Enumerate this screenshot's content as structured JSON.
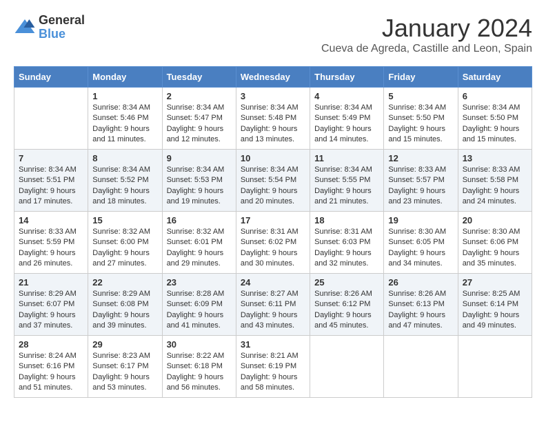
{
  "logo": {
    "general": "General",
    "blue": "Blue"
  },
  "header": {
    "month": "January 2024",
    "location": "Cueva de Agreda, Castille and Leon, Spain"
  },
  "weekdays": [
    "Sunday",
    "Monday",
    "Tuesday",
    "Wednesday",
    "Thursday",
    "Friday",
    "Saturday"
  ],
  "weeks": [
    [
      {
        "day": "",
        "sunrise": "",
        "sunset": "",
        "daylight": ""
      },
      {
        "day": "1",
        "sunrise": "Sunrise: 8:34 AM",
        "sunset": "Sunset: 5:46 PM",
        "daylight": "Daylight: 9 hours and 11 minutes."
      },
      {
        "day": "2",
        "sunrise": "Sunrise: 8:34 AM",
        "sunset": "Sunset: 5:47 PM",
        "daylight": "Daylight: 9 hours and 12 minutes."
      },
      {
        "day": "3",
        "sunrise": "Sunrise: 8:34 AM",
        "sunset": "Sunset: 5:48 PM",
        "daylight": "Daylight: 9 hours and 13 minutes."
      },
      {
        "day": "4",
        "sunrise": "Sunrise: 8:34 AM",
        "sunset": "Sunset: 5:49 PM",
        "daylight": "Daylight: 9 hours and 14 minutes."
      },
      {
        "day": "5",
        "sunrise": "Sunrise: 8:34 AM",
        "sunset": "Sunset: 5:50 PM",
        "daylight": "Daylight: 9 hours and 15 minutes."
      },
      {
        "day": "6",
        "sunrise": "Sunrise: 8:34 AM",
        "sunset": "Sunset: 5:50 PM",
        "daylight": "Daylight: 9 hours and 15 minutes."
      }
    ],
    [
      {
        "day": "7",
        "sunrise": "Sunrise: 8:34 AM",
        "sunset": "Sunset: 5:51 PM",
        "daylight": "Daylight: 9 hours and 17 minutes."
      },
      {
        "day": "8",
        "sunrise": "Sunrise: 8:34 AM",
        "sunset": "Sunset: 5:52 PM",
        "daylight": "Daylight: 9 hours and 18 minutes."
      },
      {
        "day": "9",
        "sunrise": "Sunrise: 8:34 AM",
        "sunset": "Sunset: 5:53 PM",
        "daylight": "Daylight: 9 hours and 19 minutes."
      },
      {
        "day": "10",
        "sunrise": "Sunrise: 8:34 AM",
        "sunset": "Sunset: 5:54 PM",
        "daylight": "Daylight: 9 hours and 20 minutes."
      },
      {
        "day": "11",
        "sunrise": "Sunrise: 8:34 AM",
        "sunset": "Sunset: 5:55 PM",
        "daylight": "Daylight: 9 hours and 21 minutes."
      },
      {
        "day": "12",
        "sunrise": "Sunrise: 8:33 AM",
        "sunset": "Sunset: 5:57 PM",
        "daylight": "Daylight: 9 hours and 23 minutes."
      },
      {
        "day": "13",
        "sunrise": "Sunrise: 8:33 AM",
        "sunset": "Sunset: 5:58 PM",
        "daylight": "Daylight: 9 hours and 24 minutes."
      }
    ],
    [
      {
        "day": "14",
        "sunrise": "Sunrise: 8:33 AM",
        "sunset": "Sunset: 5:59 PM",
        "daylight": "Daylight: 9 hours and 26 minutes."
      },
      {
        "day": "15",
        "sunrise": "Sunrise: 8:32 AM",
        "sunset": "Sunset: 6:00 PM",
        "daylight": "Daylight: 9 hours and 27 minutes."
      },
      {
        "day": "16",
        "sunrise": "Sunrise: 8:32 AM",
        "sunset": "Sunset: 6:01 PM",
        "daylight": "Daylight: 9 hours and 29 minutes."
      },
      {
        "day": "17",
        "sunrise": "Sunrise: 8:31 AM",
        "sunset": "Sunset: 6:02 PM",
        "daylight": "Daylight: 9 hours and 30 minutes."
      },
      {
        "day": "18",
        "sunrise": "Sunrise: 8:31 AM",
        "sunset": "Sunset: 6:03 PM",
        "daylight": "Daylight: 9 hours and 32 minutes."
      },
      {
        "day": "19",
        "sunrise": "Sunrise: 8:30 AM",
        "sunset": "Sunset: 6:05 PM",
        "daylight": "Daylight: 9 hours and 34 minutes."
      },
      {
        "day": "20",
        "sunrise": "Sunrise: 8:30 AM",
        "sunset": "Sunset: 6:06 PM",
        "daylight": "Daylight: 9 hours and 35 minutes."
      }
    ],
    [
      {
        "day": "21",
        "sunrise": "Sunrise: 8:29 AM",
        "sunset": "Sunset: 6:07 PM",
        "daylight": "Daylight: 9 hours and 37 minutes."
      },
      {
        "day": "22",
        "sunrise": "Sunrise: 8:29 AM",
        "sunset": "Sunset: 6:08 PM",
        "daylight": "Daylight: 9 hours and 39 minutes."
      },
      {
        "day": "23",
        "sunrise": "Sunrise: 8:28 AM",
        "sunset": "Sunset: 6:09 PM",
        "daylight": "Daylight: 9 hours and 41 minutes."
      },
      {
        "day": "24",
        "sunrise": "Sunrise: 8:27 AM",
        "sunset": "Sunset: 6:11 PM",
        "daylight": "Daylight: 9 hours and 43 minutes."
      },
      {
        "day": "25",
        "sunrise": "Sunrise: 8:26 AM",
        "sunset": "Sunset: 6:12 PM",
        "daylight": "Daylight: 9 hours and 45 minutes."
      },
      {
        "day": "26",
        "sunrise": "Sunrise: 8:26 AM",
        "sunset": "Sunset: 6:13 PM",
        "daylight": "Daylight: 9 hours and 47 minutes."
      },
      {
        "day": "27",
        "sunrise": "Sunrise: 8:25 AM",
        "sunset": "Sunset: 6:14 PM",
        "daylight": "Daylight: 9 hours and 49 minutes."
      }
    ],
    [
      {
        "day": "28",
        "sunrise": "Sunrise: 8:24 AM",
        "sunset": "Sunset: 6:16 PM",
        "daylight": "Daylight: 9 hours and 51 minutes."
      },
      {
        "day": "29",
        "sunrise": "Sunrise: 8:23 AM",
        "sunset": "Sunset: 6:17 PM",
        "daylight": "Daylight: 9 hours and 53 minutes."
      },
      {
        "day": "30",
        "sunrise": "Sunrise: 8:22 AM",
        "sunset": "Sunset: 6:18 PM",
        "daylight": "Daylight: 9 hours and 56 minutes."
      },
      {
        "day": "31",
        "sunrise": "Sunrise: 8:21 AM",
        "sunset": "Sunset: 6:19 PM",
        "daylight": "Daylight: 9 hours and 58 minutes."
      },
      {
        "day": "",
        "sunrise": "",
        "sunset": "",
        "daylight": ""
      },
      {
        "day": "",
        "sunrise": "",
        "sunset": "",
        "daylight": ""
      },
      {
        "day": "",
        "sunrise": "",
        "sunset": "",
        "daylight": ""
      }
    ]
  ]
}
